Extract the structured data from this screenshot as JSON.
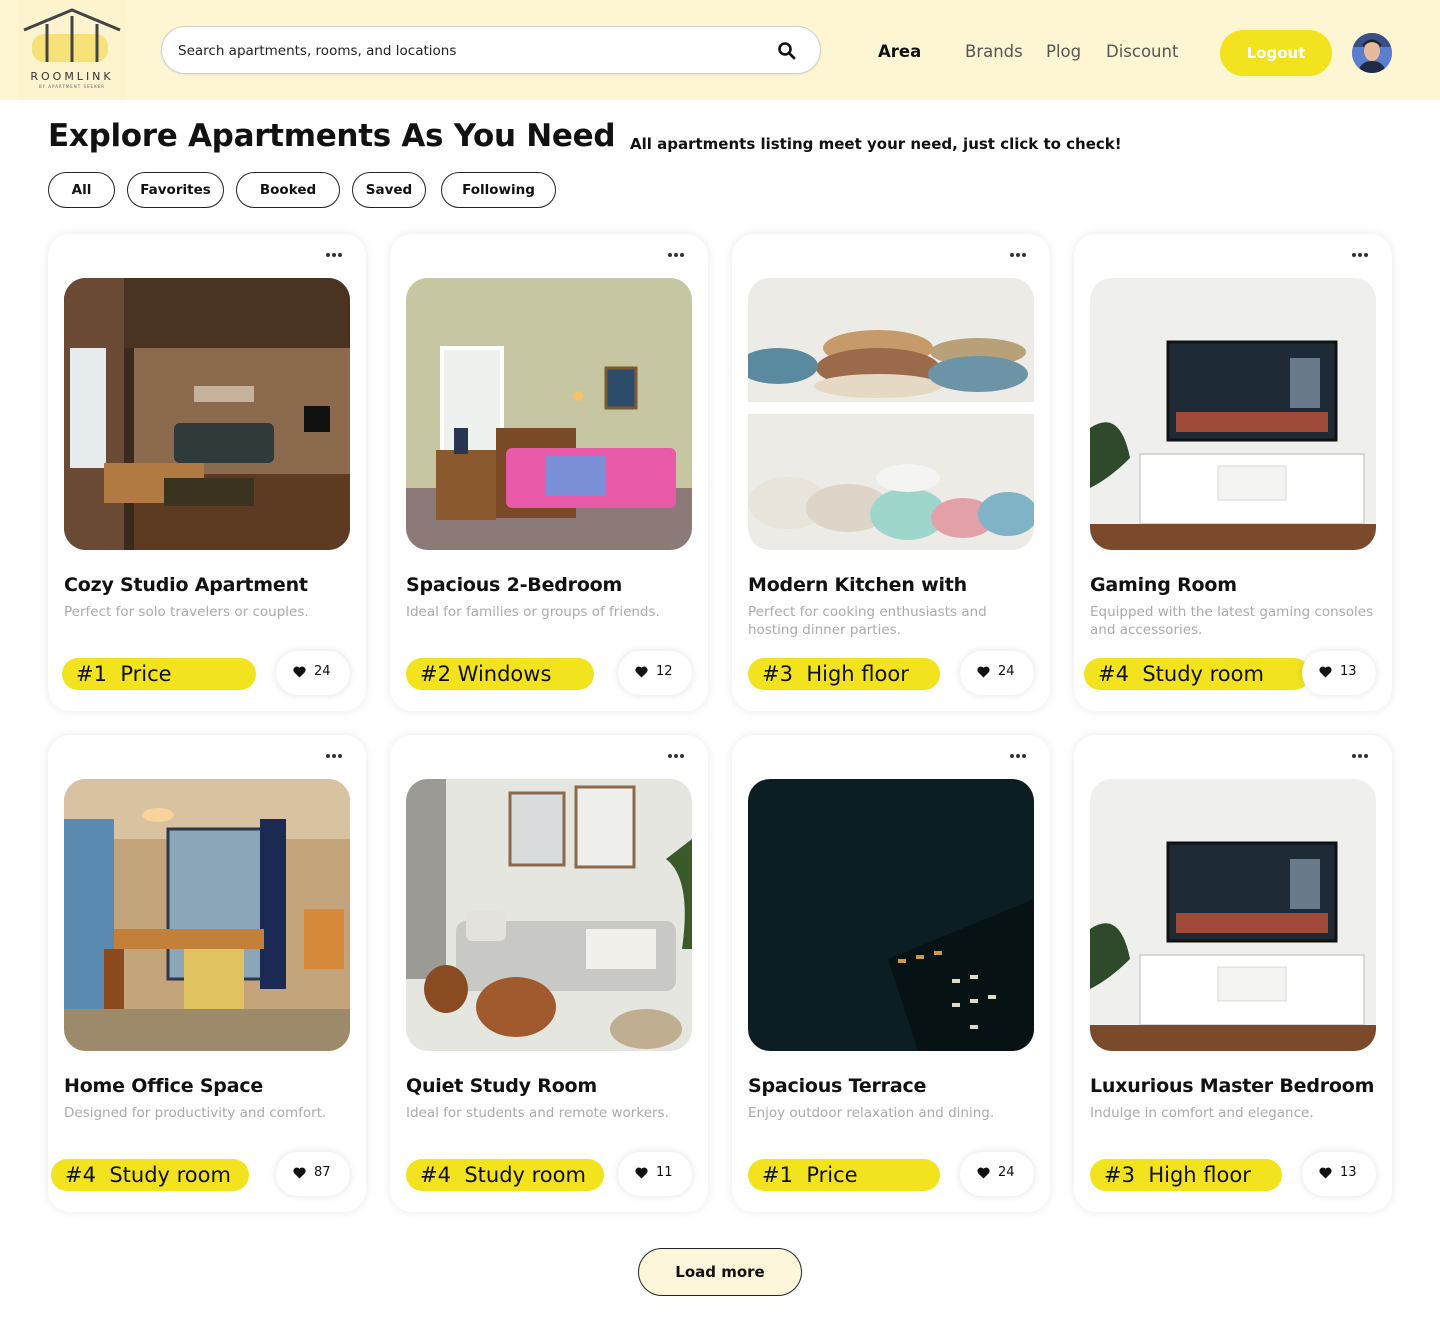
{
  "brand": {
    "name": "ROOMLINK",
    "tagline": "BY APARTMENT SEEKER"
  },
  "search": {
    "placeholder": "Search apartments, rooms, and locations"
  },
  "nav": {
    "area": "Area",
    "brands": "Brands",
    "plog": "Plog",
    "discount": "Discount"
  },
  "auth": {
    "logout_label": "Logout"
  },
  "page": {
    "title": "Explore Apartments As You Need",
    "subtitle": "All apartments listing meet your need, just click to check!"
  },
  "filters": [
    "All",
    "Favorites",
    "Booked",
    "Saved",
    "Following"
  ],
  "cards": [
    {
      "title": "Cozy Studio Apartment",
      "desc": "Perfect for solo travelers or couples.",
      "tag_rank": "#1",
      "tag_label": "Price",
      "likes": "24",
      "image": "studio-living-room"
    },
    {
      "title": "Spacious 2-Bedroom",
      "desc": "Ideal for families or groups of friends.",
      "tag_rank": "#2",
      "tag_label": "Windows",
      "likes": "12",
      "image": "bedroom"
    },
    {
      "title": "Modern Kitchen with",
      "desc": "Perfect for cooking enthusiasts and hosting dinner parties.",
      "tag_rank": "#3",
      "tag_label": "High floor",
      "likes": "24",
      "image": "kitchen-dishes"
    },
    {
      "title": "Gaming Room",
      "desc": "Equipped with the latest gaming consoles and accessories.",
      "tag_rank": "#4",
      "tag_label": "Study room",
      "likes": "13",
      "image": "tv-room"
    },
    {
      "title": "Home Office Space",
      "desc": "Designed for productivity and comfort.",
      "tag_rank": "#4",
      "tag_label": "Study room",
      "likes": "87",
      "image": "home-office"
    },
    {
      "title": "Quiet Study Room",
      "desc": "Ideal for students and remote workers.",
      "tag_rank": "#4",
      "tag_label": "Study room",
      "likes": "11",
      "image": "lounge-sofa"
    },
    {
      "title": "Spacious Terrace",
      "desc": "Enjoy outdoor relaxation and dining.",
      "tag_rank": "#1",
      "tag_label": "Price",
      "likes": "24",
      "image": "night-building"
    },
    {
      "title": "Luxurious Master Bedroom",
      "desc": "Indulge in comfort and elegance.",
      "tag_rank": "#3",
      "tag_label": "High floor",
      "likes": "13",
      "image": "tv-room"
    }
  ],
  "load_more_label": "Load more",
  "colors": {
    "accent": "#f2e31e",
    "header_bg": "#fef6d3",
    "load_more_bg": "#fdf6da"
  }
}
